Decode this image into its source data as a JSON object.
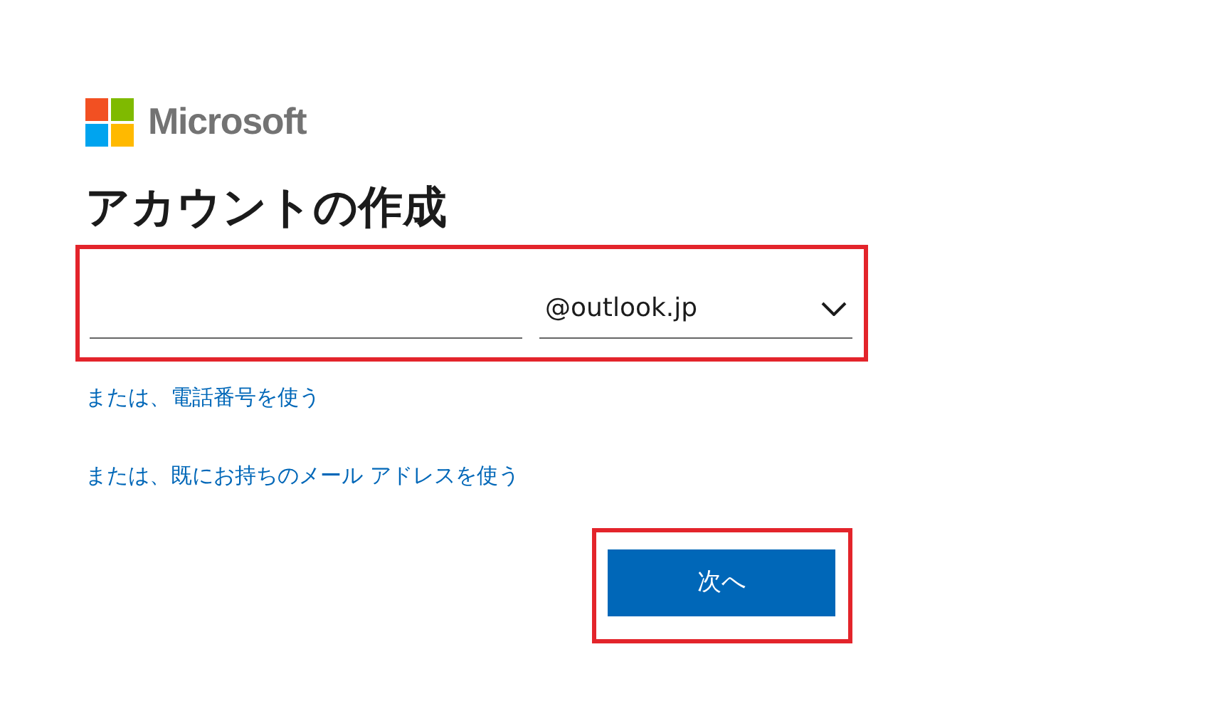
{
  "logo": {
    "text": "Microsoft"
  },
  "heading": "アカウントの作成",
  "email": {
    "highlighted": true,
    "domain": "@outlook.jp"
  },
  "links": [
    "または、電話番号を使う",
    "または、既にお持ちのメール アドレスを使う"
  ],
  "next_button": {
    "label": "次へ",
    "highlighted": true
  }
}
